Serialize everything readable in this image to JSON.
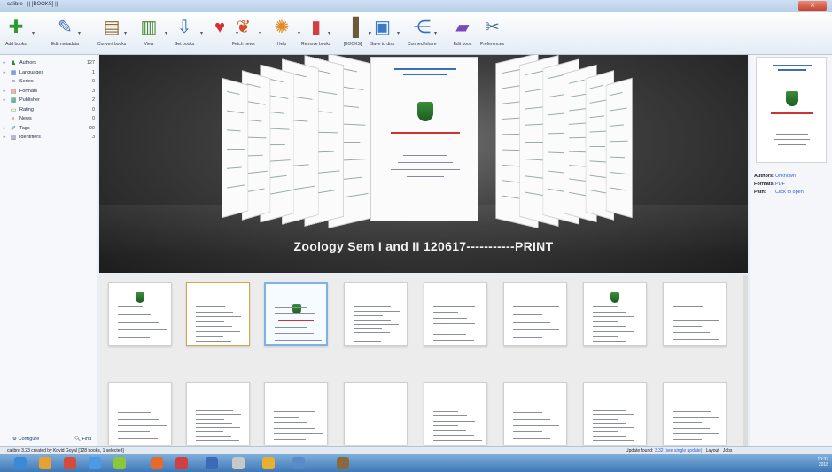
{
  "window": {
    "title": "calibre - || [BOOKS] ||"
  },
  "toolbar": {
    "buttons": [
      {
        "label": "Add books",
        "icon": "add-books-icon",
        "glyph": "✚",
        "color": "#2e9a2e"
      },
      {
        "label": "Edit metadata",
        "icon": "edit-metadata-icon",
        "glyph": "✎",
        "color": "#3a6fb8"
      },
      {
        "label": "Convert books",
        "icon": "convert-books-icon",
        "glyph": "▤",
        "color": "#8a6a2a"
      },
      {
        "label": "View",
        "icon": "view-icon",
        "glyph": "▥",
        "color": "#4a8a3a"
      },
      {
        "label": "Get books",
        "icon": "get-books-icon",
        "glyph": "⇩",
        "color": "#2f6fb0"
      },
      {
        "label": "",
        "icon": "heart-icon",
        "glyph": "♥",
        "color": "#d63030"
      },
      {
        "label": "Fetch news",
        "icon": "fetch-news-icon",
        "glyph": "❦",
        "color": "#d05020"
      },
      {
        "label": "Help",
        "icon": "help-icon",
        "glyph": "✺",
        "color": "#e08a20"
      },
      {
        "label": "Remove books",
        "icon": "remove-books-icon",
        "glyph": "▮",
        "color": "#d04040"
      },
      {
        "label": "[BOOKS]",
        "icon": "library-icon",
        "glyph": "▐",
        "color": "#6a5a3a"
      },
      {
        "label": "Save to disk",
        "icon": "save-to-disk-icon",
        "glyph": "▣",
        "color": "#3a7ac8"
      },
      {
        "label": "Connect/share",
        "icon": "connect-share-icon",
        "glyph": "⋲",
        "color": "#3a6fb8"
      },
      {
        "label": "Edit book",
        "icon": "edit-book-icon",
        "glyph": "▰",
        "color": "#7a4ab8"
      },
      {
        "label": "Preferences",
        "icon": "preferences-icon",
        "glyph": "✂",
        "color": "#4a6a8a"
      }
    ]
  },
  "tag_browser": {
    "items": [
      {
        "label": "Authors",
        "count": "127",
        "icon": "authors-icon",
        "glyph": "♟",
        "color": "#2e8a2e",
        "expand": "▸"
      },
      {
        "label": "Languages",
        "count": "1",
        "icon": "languages-icon",
        "glyph": "▦",
        "color": "#3a6fb8",
        "expand": "▸"
      },
      {
        "label": "Series",
        "count": "0",
        "icon": "series-icon",
        "glyph": "≡",
        "color": "#5a7ab8",
        "expand": ""
      },
      {
        "label": "Formats",
        "count": "3",
        "icon": "formats-icon",
        "glyph": "▤",
        "color": "#b85a2a",
        "expand": "▸"
      },
      {
        "label": "Publisher",
        "count": "2",
        "icon": "publisher-icon",
        "glyph": "▩",
        "color": "#2e8a6a",
        "expand": "▸"
      },
      {
        "label": "Rating",
        "count": "0",
        "icon": "rating-icon",
        "glyph": "▭",
        "color": "#8a8a3a",
        "expand": ""
      },
      {
        "label": "News",
        "count": "0",
        "icon": "news-icon",
        "glyph": "♀",
        "color": "#c83a3a",
        "expand": ""
      },
      {
        "label": "Tags",
        "count": "90",
        "icon": "tags-icon",
        "glyph": "✐",
        "color": "#3a6fb8",
        "expand": "▸"
      },
      {
        "label": "Identifiers",
        "count": "3",
        "icon": "identifiers-icon",
        "glyph": "▥",
        "color": "#5a5a8a",
        "expand": "▸"
      }
    ],
    "configure_label": "Configure",
    "find_label": "Find"
  },
  "cover_flow": {
    "current_title": "Zoology Sem I and II 120617-----------PRINT"
  },
  "book_details": {
    "authors_key": "Authors:",
    "authors_val": "Unknown",
    "formats_key": "Formats:",
    "formats_val": "PDF",
    "path_key": "Path:",
    "path_val": "Click to open"
  },
  "statusbar": {
    "left": "calibre 3.23 created by Kovid Goyal  [128 books, 1 selected]",
    "update_prefix": "Update found: ",
    "update_link": "3.32 (see single update)",
    "layout_label": "Layout",
    "jobs_label": "Jobs"
  },
  "taskbar": {
    "time": "10:37",
    "date": "2018"
  },
  "colors": {
    "selection": "#7fb1e6",
    "link": "#2b5ed8"
  }
}
